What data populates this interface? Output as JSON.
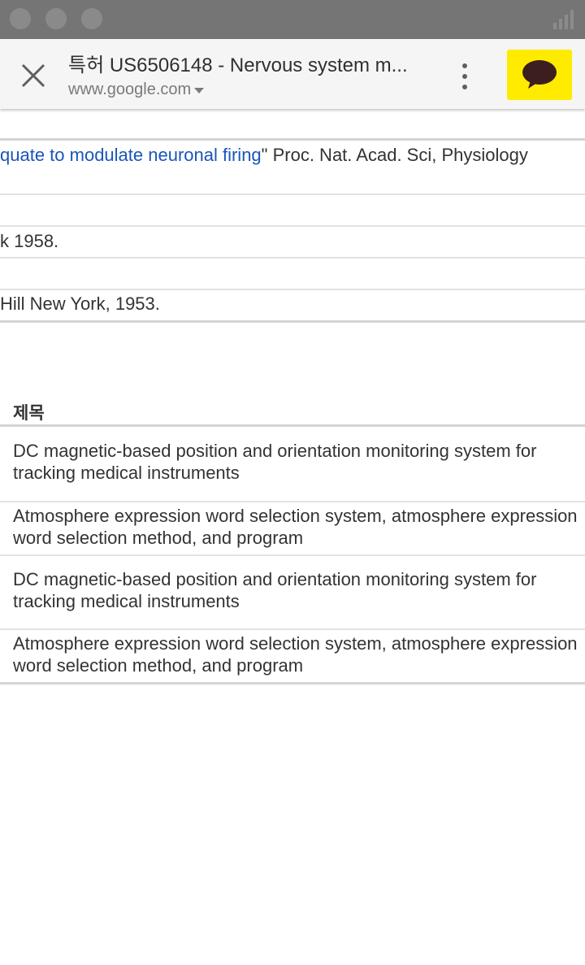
{
  "toolbar": {
    "title": "특허 US6506148 - Nervous system m...",
    "url": "www.google.com"
  },
  "references": {
    "row1_link": "quate to modulate neuronal firing",
    "row1_rest": "\" Proc. Nat. Acad. Sci, Physiology",
    "row2": "k 1958.",
    "row3": "Hill New York, 1953."
  },
  "results": {
    "header": "제목",
    "items": [
      "DC magnetic-based position and orientation monitoring system for tracking medical instruments",
      "Atmosphere expression word selection system, atmosphere expression word selection method, and program",
      "DC magnetic-based position and orientation monitoring system for tracking medical instruments",
      "Atmosphere expression word selection system, atmosphere expression word selection method, and program"
    ]
  },
  "colors": {
    "chat_button": "#ffeb00",
    "link": "#1a55b8",
    "status_bar": "#757575"
  }
}
